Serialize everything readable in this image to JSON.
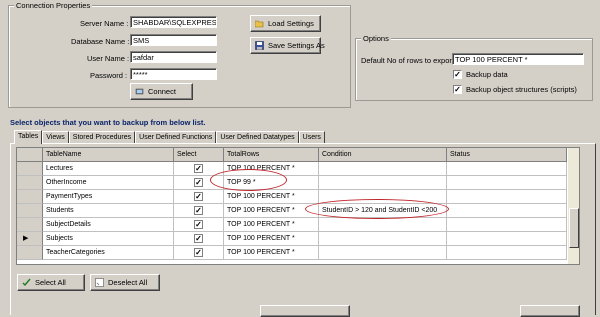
{
  "connection": {
    "title": "Connection Properties",
    "server_label": "Server Name :",
    "server_value": "SHABDAR\\SQLEXPRESS",
    "database_label": "Database Name :",
    "database_value": "SMS",
    "user_label": "User Name :",
    "user_value": "safdar",
    "password_label": "Password :",
    "password_value": "*****",
    "load_button": "Load Settings",
    "save_button": "Save Settings As",
    "connect_button": "Connect"
  },
  "options": {
    "title": "Options",
    "rows_label": "Default No of rows to export :",
    "rows_value": "TOP 100 PERCENT *",
    "backup_data_label": "Backup data",
    "backup_data_checked": true,
    "backup_structures_label": "Backup object structures (scripts)",
    "backup_structures_checked": true
  },
  "instruction": "Select objects that you want to backup from below list.",
  "tabs": [
    "Tables",
    "Views",
    "Stored Procedures",
    "User Defined Functions",
    "User Defined Datatypes",
    "Users"
  ],
  "active_tab": "Tables",
  "grid": {
    "columns": [
      "TableName",
      "Select",
      "TotalRows",
      "Condition",
      "Status"
    ],
    "rows": [
      {
        "name": "Lectures",
        "selected": true,
        "total_rows": "TOP 100 PERCENT *",
        "condition": "",
        "status": "",
        "current": false
      },
      {
        "name": "OtherIncome",
        "selected": true,
        "total_rows": "TOP  99  *",
        "condition": "",
        "status": "",
        "current": false
      },
      {
        "name": "PaymentTypes",
        "selected": true,
        "total_rows": "TOP 100 PERCENT *",
        "condition": "",
        "status": "",
        "current": false
      },
      {
        "name": "Students",
        "selected": true,
        "total_rows": "TOP 100 PERCENT *",
        "condition": "StudentID > 120 and StudentID <200",
        "status": "",
        "current": false
      },
      {
        "name": "SubjectDetails",
        "selected": true,
        "total_rows": "TOP 100 PERCENT *",
        "condition": "",
        "status": "",
        "current": false
      },
      {
        "name": "Subjects",
        "selected": true,
        "total_rows": "TOP 100 PERCENT *",
        "condition": "",
        "status": "",
        "current": true
      },
      {
        "name": "TeacherCategories",
        "selected": true,
        "total_rows": "TOP 100 PERCENT *",
        "condition": "",
        "status": "",
        "current": false
      }
    ]
  },
  "select_all_button": "Select All",
  "deselect_all_button": "Deselect All",
  "colors": {
    "window_bg": "#d4d0c8",
    "instruction_text": "#0a246a",
    "annotation_ellipse": "#c0262b",
    "check_green": "#1f7a1f"
  }
}
